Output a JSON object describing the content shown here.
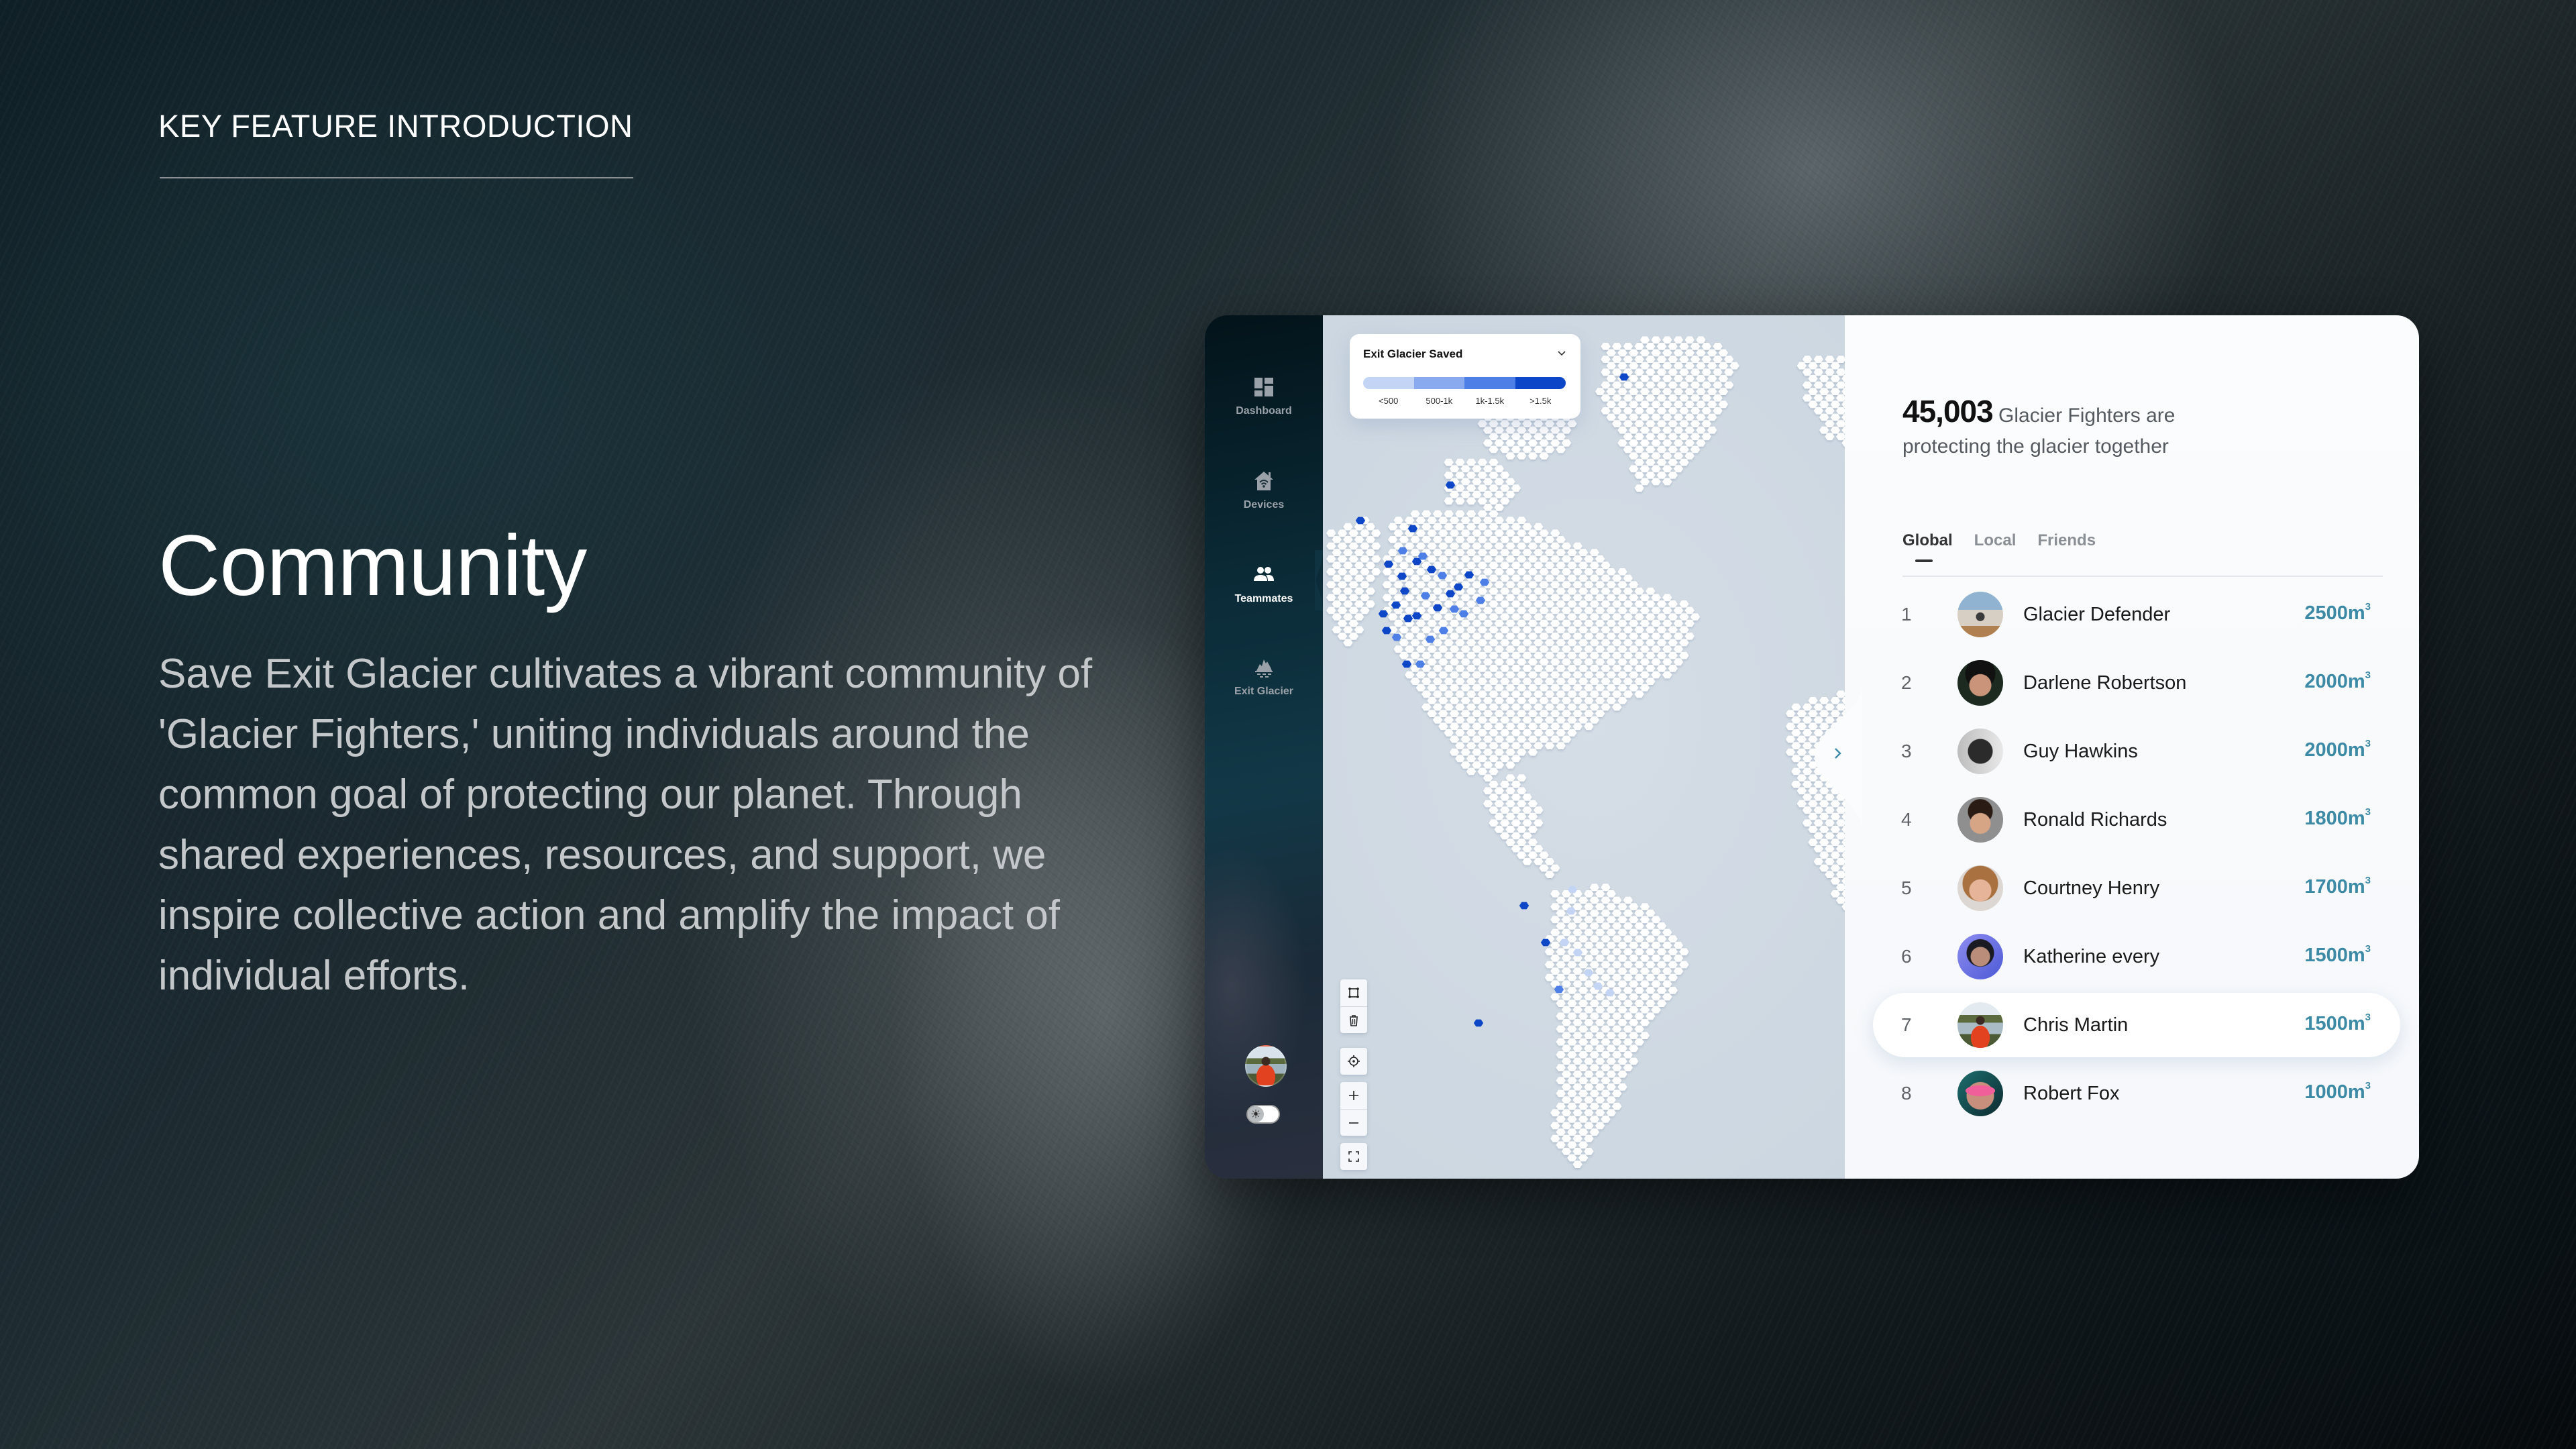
{
  "page": {
    "kicker": "KEY FEATURE INTRODUCTION",
    "title": "Community",
    "body": "Save Exit Glacier cultivates a vibrant community of 'Glacier Fighters,' uniting individuals around the common goal of protecting our planet. Through shared experiences, resources, and support, we inspire collective action and amplify the impact of individual efforts."
  },
  "sidebar": {
    "items": [
      {
        "label": "Dashboard",
        "icon": "dashboard-icon",
        "active": false
      },
      {
        "label": "Devices",
        "icon": "smart-home-icon",
        "active": false
      },
      {
        "label": "Teammates",
        "icon": "teammates-icon",
        "active": true
      },
      {
        "label": "Exit Glacier",
        "icon": "glacier-icon",
        "active": false
      }
    ],
    "theme": "light"
  },
  "map": {
    "legend": {
      "title": "Exit Glacier Saved",
      "ranges": [
        "<500",
        "500-1k",
        "1k-1.5k",
        ">1.5k"
      ],
      "colors": [
        "#c3d4f5",
        "#8aaaf0",
        "#4d7fe6",
        "#0d47c7"
      ]
    },
    "tools": [
      "select-area",
      "delete",
      "locate",
      "zoom-in",
      "zoom-out",
      "fullscreen"
    ]
  },
  "community": {
    "count": "45,003",
    "count_text_1": " Glacier Fighters are",
    "count_text_2": "protecting the glacier together",
    "tabs": [
      "Global",
      "Local",
      "Friends"
    ],
    "active_tab": "Global",
    "unit": "m",
    "unit_sup": "3",
    "accent": "#3d8aa6",
    "leaderboard": [
      {
        "rank": "1",
        "name": "Glacier Defender",
        "score": "2500"
      },
      {
        "rank": "2",
        "name": "Darlene Robertson",
        "score": "2000"
      },
      {
        "rank": "3",
        "name": "Guy Hawkins",
        "score": "2000"
      },
      {
        "rank": "4",
        "name": "Ronald Richards",
        "score": "1800"
      },
      {
        "rank": "5",
        "name": "Courtney Henry",
        "score": "1700"
      },
      {
        "rank": "6",
        "name": "Katherine every",
        "score": "1500"
      },
      {
        "rank": "7",
        "name": "Chris Martin",
        "score": "1500",
        "highlighted": true
      },
      {
        "rank": "8",
        "name": "Robert Fox",
        "score": "1000"
      }
    ]
  }
}
